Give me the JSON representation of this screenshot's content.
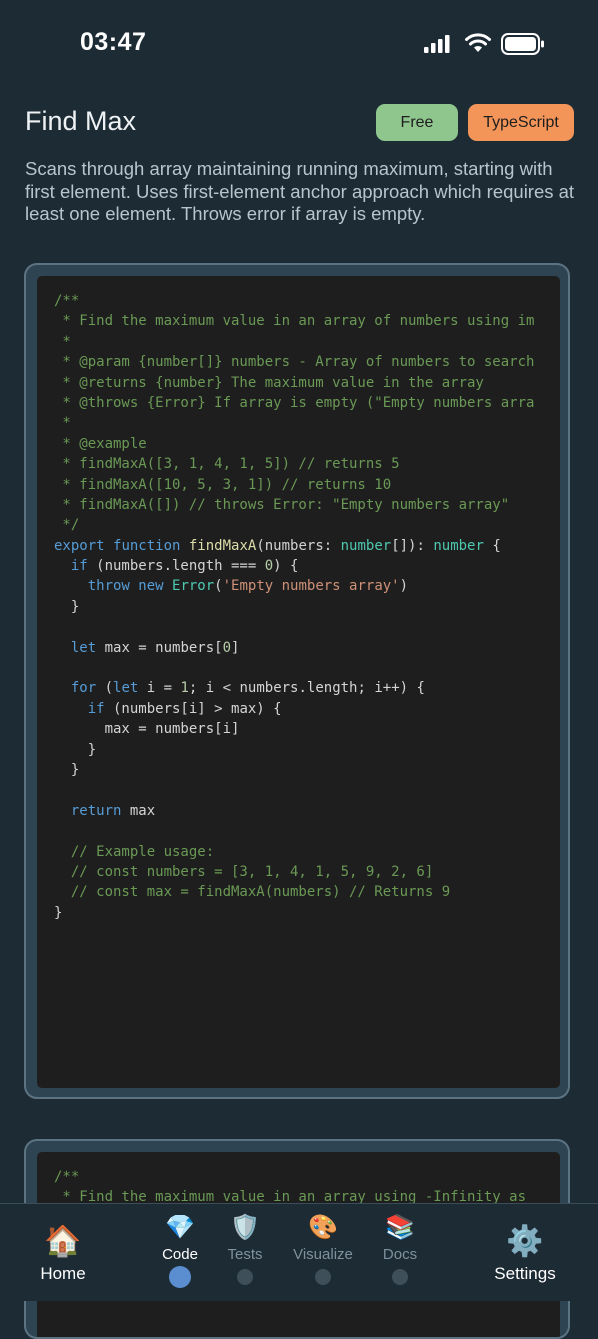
{
  "status_bar": {
    "time": "03:47"
  },
  "header": {
    "title": "Find Max",
    "badge_tier": "Free",
    "badge_language": "TypeScript",
    "description": "Scans through array maintaining running maximum, starting with first element. Uses first-element anchor approach which requires at least one element. Throws error if array is empty."
  },
  "code": {
    "lines": [
      [
        [
          "comment",
          "/**"
        ]
      ],
      [
        [
          "comment",
          " * Find the maximum value in an array of numbers using im"
        ]
      ],
      [
        [
          "comment",
          " *"
        ]
      ],
      [
        [
          "comment",
          " * @param {number[]} numbers - Array of numbers to search"
        ]
      ],
      [
        [
          "comment",
          " * @returns {number} The maximum value in the array"
        ]
      ],
      [
        [
          "comment",
          " * @throws {Error} If array is empty (\"Empty numbers arra"
        ]
      ],
      [
        [
          "comment",
          " *"
        ]
      ],
      [
        [
          "comment",
          " * @example"
        ]
      ],
      [
        [
          "comment",
          " * findMaxA([3, 1, 4, 1, 5]) // returns 5"
        ]
      ],
      [
        [
          "comment",
          " * findMaxA([10, 5, 3, 1]) // returns 10"
        ]
      ],
      [
        [
          "comment",
          " * findMaxA([]) // throws Error: \"Empty numbers array\""
        ]
      ],
      [
        [
          "comment",
          " */"
        ]
      ],
      [
        [
          "keyword",
          "export "
        ],
        [
          "keyword",
          "function "
        ],
        [
          "fn",
          "findMaxA"
        ],
        [
          "plain",
          "(numbers: "
        ],
        [
          "type",
          "number"
        ],
        [
          "plain",
          "[]): "
        ],
        [
          "type",
          "number"
        ],
        [
          "plain",
          " {"
        ]
      ],
      [
        [
          "plain",
          "  "
        ],
        [
          "keyword",
          "if"
        ],
        [
          "plain",
          " (numbers.length === "
        ],
        [
          "num",
          "0"
        ],
        [
          "plain",
          ") {"
        ]
      ],
      [
        [
          "plain",
          "    "
        ],
        [
          "keyword",
          "throw "
        ],
        [
          "keyword",
          "new "
        ],
        [
          "type",
          "Error"
        ],
        [
          "plain",
          "("
        ],
        [
          "string",
          "'Empty numbers array'"
        ],
        [
          "plain",
          ")"
        ]
      ],
      [
        [
          "plain",
          "  }"
        ]
      ],
      [
        [
          "plain",
          ""
        ]
      ],
      [
        [
          "plain",
          "  "
        ],
        [
          "keyword",
          "let"
        ],
        [
          "plain",
          " max = numbers["
        ],
        [
          "num",
          "0"
        ],
        [
          "plain",
          "]"
        ]
      ],
      [
        [
          "plain",
          ""
        ]
      ],
      [
        [
          "plain",
          "  "
        ],
        [
          "keyword",
          "for"
        ],
        [
          "plain",
          " ("
        ],
        [
          "keyword",
          "let"
        ],
        [
          "plain",
          " i = "
        ],
        [
          "num",
          "1"
        ],
        [
          "plain",
          "; i < numbers.length; i++) {"
        ]
      ],
      [
        [
          "plain",
          "    "
        ],
        [
          "keyword",
          "if"
        ],
        [
          "plain",
          " (numbers[i] > max) {"
        ]
      ],
      [
        [
          "plain",
          "      max = numbers[i]"
        ]
      ],
      [
        [
          "plain",
          "    }"
        ]
      ],
      [
        [
          "plain",
          "  }"
        ]
      ],
      [
        [
          "plain",
          ""
        ]
      ],
      [
        [
          "plain",
          "  "
        ],
        [
          "keyword",
          "return"
        ],
        [
          "plain",
          " max"
        ]
      ],
      [
        [
          "plain",
          ""
        ]
      ],
      [
        [
          "plain",
          "  "
        ],
        [
          "comment",
          "// Example usage:"
        ]
      ],
      [
        [
          "plain",
          "  "
        ],
        [
          "comment",
          "// const numbers = [3, 1, 4, 1, 5, 9, 2, 6]"
        ]
      ],
      [
        [
          "plain",
          "  "
        ],
        [
          "comment",
          "// const max = findMaxA(numbers) // Returns 9"
        ]
      ],
      [
        [
          "plain",
          "}"
        ]
      ]
    ]
  },
  "code_2": {
    "lines": [
      [
        [
          "comment",
          "/**"
        ]
      ],
      [
        [
          "comment",
          " * Find the maximum value in an array using -Infinity as"
        ]
      ]
    ]
  },
  "nav": {
    "home": {
      "label": "Home",
      "icon": "🏠"
    },
    "tabs": [
      {
        "label": "Code",
        "icon": "💎",
        "active": true
      },
      {
        "label": "Tests",
        "icon": "🛡️",
        "active": false
      },
      {
        "label": "Visualize",
        "icon": "🎨",
        "active": false
      },
      {
        "label": "Docs",
        "icon": "📚",
        "active": false
      }
    ],
    "settings": {
      "label": "Settings",
      "icon": "⚙️"
    }
  },
  "colors": {
    "background": "#1d2b35",
    "badge_free": "#8fc68e",
    "badge_language": "#f39559",
    "active_dot": "#5b8ed0"
  }
}
